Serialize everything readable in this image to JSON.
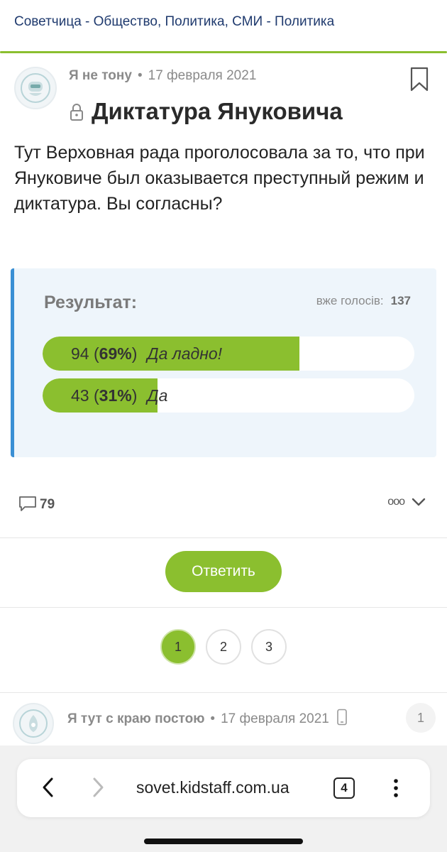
{
  "breadcrumb": "Советчица - Общество, Политика, СМИ - Политика",
  "post": {
    "author": "Я не тону",
    "separator": "•",
    "date": "17 февраля 2021",
    "title": "Диктатура Януковича",
    "body": "Тут Верховная рада проголосовала за то, что при Януковиче был оказывается преступный режим и диктатура. Вы согласны?"
  },
  "poll": {
    "title": "Результат:",
    "votes_label": "вже голосів:",
    "votes_total": "137",
    "options": [
      {
        "count": "94",
        "percent_text": "69%",
        "percent": 69,
        "answer": "Да ладно!"
      },
      {
        "count": "43",
        "percent_text": "31%",
        "percent": 31,
        "answer": "Да"
      }
    ]
  },
  "actions": {
    "comments_count": "79",
    "more": "ooo"
  },
  "reply_label": "Ответить",
  "pagination": [
    "1",
    "2",
    "3"
  ],
  "comment": {
    "author": "Я тут с краю постою",
    "separator": "•",
    "date": "17 февраля 2021",
    "number": "1"
  },
  "browser": {
    "url": "sovet.kidstaff.com.ua",
    "tab_count": "4"
  },
  "colors": {
    "accent_green": "#8bbf2f",
    "poll_border_blue": "#3a8fd4",
    "poll_bg": "#eef5fb"
  }
}
